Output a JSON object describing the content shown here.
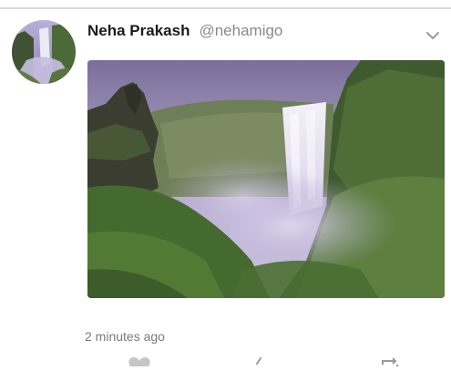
{
  "tweet": {
    "author": {
      "display_name": "Neha Prakash",
      "handle": "@nehamigo",
      "avatar": "waterfall-avatar"
    },
    "media": {
      "type": "photo",
      "subject": "waterfall-landscape"
    },
    "timestamp": "2 minutes ago",
    "actions": [
      "heart-icon",
      "reply-icon",
      "retweet-icon"
    ],
    "menu_icon": "chevron-down-icon"
  },
  "colors": {
    "name": "#1b1b1b",
    "handle": "#8a8a8a",
    "timestamp": "#7a7a7a",
    "divider": "#d8d8d8",
    "icon": "#c6c6c6"
  }
}
